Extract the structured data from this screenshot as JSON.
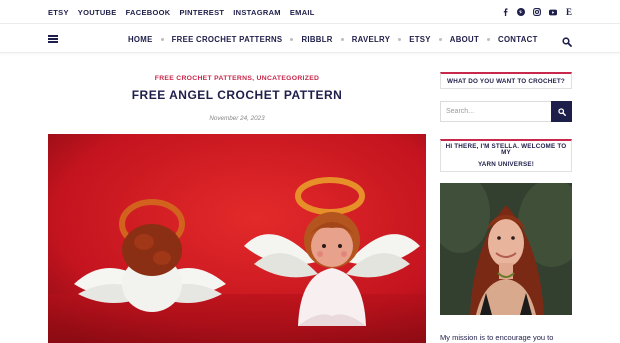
{
  "topbar": {
    "links": [
      "ETSY",
      "YOUTUBE",
      "FACEBOOK",
      "PINTEREST",
      "INSTAGRAM",
      "EMAIL"
    ],
    "social_icons": [
      "facebook-icon",
      "pinterest-icon",
      "instagram-icon",
      "youtube-icon",
      "etsy-icon"
    ],
    "etsy_glyph": "E"
  },
  "nav": {
    "items": [
      "HOME",
      "FREE CROCHET PATTERNS",
      "RIBBLR",
      "RAVELRY",
      "ETSY",
      "ABOUT",
      "CONTACT"
    ]
  },
  "post": {
    "categories": "FREE CROCHET PATTERNS, UNCATEGORIZED",
    "title": "FREE ANGEL CROCHET PATTERN",
    "date": "November 24, 2023"
  },
  "sidebar": {
    "search_heading": "WHAT DO YOU WANT TO CROCHET?",
    "search_placeholder": "Search...",
    "welcome_heading_line1": "HI THERE, I'M STELLA. WELCOME TO MY",
    "welcome_heading_line2": "YARN UNIVERSE!",
    "mission_text": "My mission is to encourage you to"
  },
  "colors": {
    "navy": "#1e1e4a",
    "accent": "#c7284b",
    "hero_background": "#c4141f"
  }
}
